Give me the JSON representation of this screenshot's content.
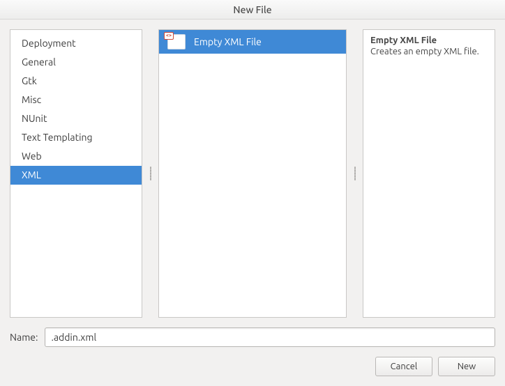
{
  "window": {
    "title": "New File"
  },
  "categories": [
    {
      "label": "Deployment",
      "selected": false
    },
    {
      "label": "General",
      "selected": false
    },
    {
      "label": "Gtk",
      "selected": false
    },
    {
      "label": "Misc",
      "selected": false
    },
    {
      "label": "NUnit",
      "selected": false
    },
    {
      "label": "Text Templating",
      "selected": false
    },
    {
      "label": "Web",
      "selected": false
    },
    {
      "label": "XML",
      "selected": true
    }
  ],
  "templates": [
    {
      "label": "Empty XML File",
      "icon": "xml-file-icon",
      "badge": "<>",
      "selected": true
    }
  ],
  "description": {
    "title": "Empty XML File",
    "body": "Creates an empty XML file."
  },
  "name_field": {
    "label": "Name:",
    "value": ".addin.xml"
  },
  "buttons": {
    "cancel": "Cancel",
    "new": "New"
  },
  "colors": {
    "selection": "#3f89d6",
    "window_bg": "#f2f1f0",
    "panel_border": "#c9c7c5"
  }
}
